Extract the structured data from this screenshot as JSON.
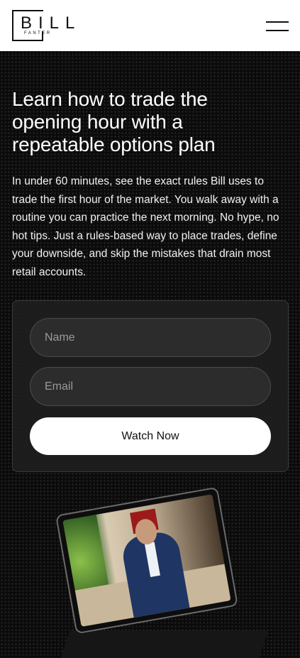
{
  "header": {
    "logo_word": "BILL",
    "logo_sub": "FANTER"
  },
  "hero": {
    "title": "Learn how to trade the opening hour with a repeatable options plan",
    "body": "In under 60 minutes, see the exact rules Bill uses to trade the first hour of the market. You walk away with a routine you can practice the next morning. No hype, no hot tips. Just a rules-based way to place trades, define your downside, and skip the mistakes that drain most retail accounts."
  },
  "form": {
    "name_placeholder": "Name",
    "email_placeholder": "Email",
    "submit_label": "Watch Now"
  },
  "icons": {
    "menu": "hamburger-menu-icon"
  }
}
